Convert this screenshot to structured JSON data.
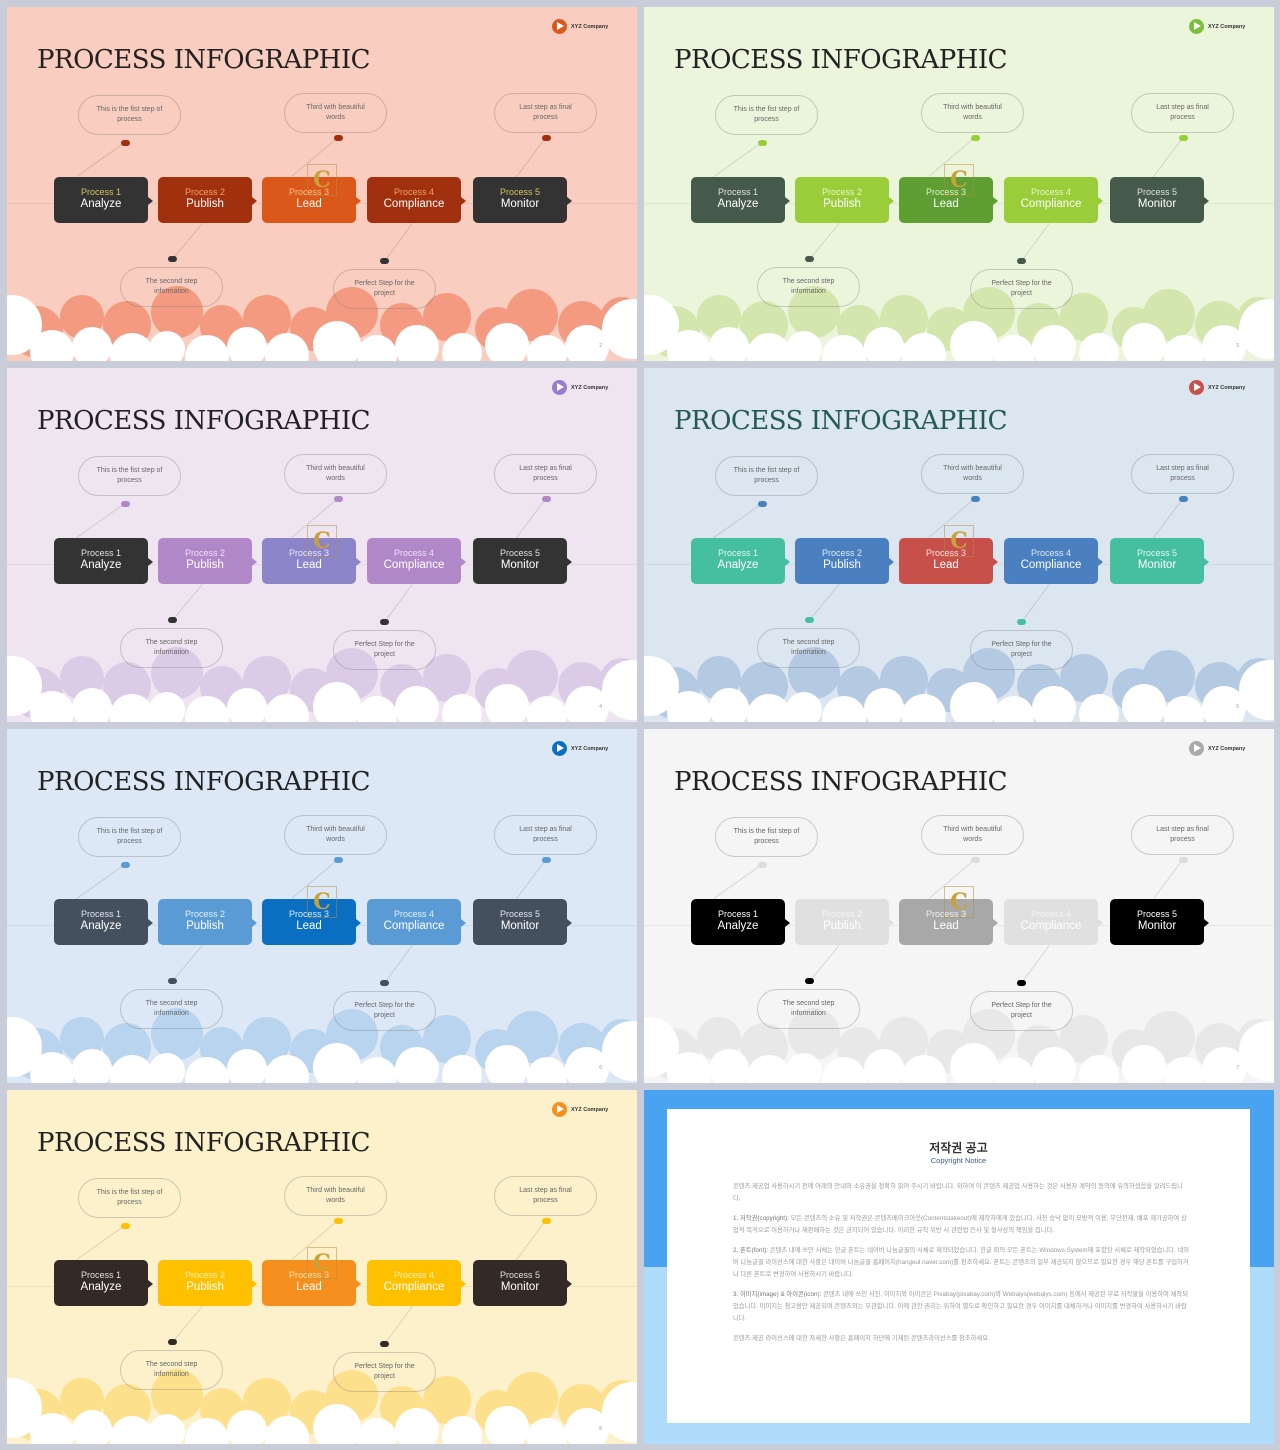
{
  "common": {
    "title": "PROCESS INFOGRAPHIC",
    "logo_text": "XYZ Company",
    "processes": [
      {
        "label": "Process 1",
        "name": "Analyze"
      },
      {
        "label": "Process 2",
        "name": "Publish"
      },
      {
        "label": "Process 3",
        "name": "Lead"
      },
      {
        "label": "Process 4",
        "name": "Compliance"
      },
      {
        "label": "Process 5",
        "name": "Monitor"
      }
    ],
    "bubbles_top": [
      "This is the fist step of process",
      "Third with beautiful words",
      "Last step as final process"
    ],
    "bubbles_bottom": [
      "The second step information",
      "Perfect Step for the project"
    ],
    "watermark": "C"
  },
  "slides": [
    {
      "page": "2",
      "bg": "#f9cdbf",
      "cloud": "#f39a80",
      "title_color": "#222222",
      "logo": "#d9581a",
      "boxes": [
        "#333333",
        "#a1300f",
        "#d9581a",
        "#a1300f",
        "#333333"
      ],
      "labels": [
        "#d8c060",
        "#f0a060",
        "#f8c090",
        "#f0a060",
        "#d8c060"
      ],
      "dot_top": "#a1300f",
      "dot_bottom": "#333333"
    },
    {
      "page": "3",
      "bg": "#ebf5dc",
      "cloud": "#d2e6ad",
      "title_color": "#222222",
      "logo": "#7cbf3a",
      "boxes": [
        "#455a4a",
        "#9acd3a",
        "#5e9e32",
        "#9acd3a",
        "#455a4a"
      ],
      "labels": [
        "#e0e0e0",
        "#e8f5c8",
        "#e0f0c8",
        "#e8f5c8",
        "#e0e0e0"
      ],
      "dot_top": "#9acd3a",
      "dot_bottom": "#455a4a"
    },
    {
      "page": "4",
      "bg": "#eee5f0",
      "cloud": "#dccbe7",
      "title_color": "#222222",
      "logo": "#9a7cc8",
      "boxes": [
        "#333333",
        "#b088c8",
        "#8c84c8",
        "#b088c8",
        "#333333"
      ],
      "labels": [
        "#e0e0e0",
        "#efe0f8",
        "#e8e6f8",
        "#efe0f8",
        "#e0e0e0"
      ],
      "dot_top": "#b088c8",
      "dot_bottom": "#333333"
    },
    {
      "page": "5",
      "bg": "#dce6f0",
      "cloud": "#b4c9e2",
      "title_color": "#245a55",
      "logo": "#c8504a",
      "boxes": [
        "#45bfa0",
        "#4a7fc0",
        "#c8504a",
        "#4a7fc0",
        "#45bfa0"
      ],
      "labels": [
        "#e0f8f0",
        "#e0ecf8",
        "#f8e0e0",
        "#e0ecf8",
        "#e0f8f0"
      ],
      "dot_top": "#4a7fc0",
      "dot_bottom": "#45bfa0"
    },
    {
      "page": "6",
      "bg": "#dce8f6",
      "cloud": "#b8d4ee",
      "title_color": "#222222",
      "logo": "#0a6fc0",
      "boxes": [
        "#45505f",
        "#5b9bd5",
        "#0a6fc0",
        "#5b9bd5",
        "#45505f"
      ],
      "labels": [
        "#e0e6ee",
        "#e6f0fa",
        "#d8eafa",
        "#e6f0fa",
        "#e0e6ee"
      ],
      "dot_top": "#5b9bd5",
      "dot_bottom": "#45505f"
    },
    {
      "page": "7",
      "bg": "#f5f5f5",
      "cloud": "#e8e8e8",
      "title_color": "#222222",
      "logo": "#aaaaaa",
      "boxes": [
        "#000000",
        "#e0e0e0",
        "#a8a8a8",
        "#e0e0e0",
        "#000000"
      ],
      "labels": [
        "#ffffff",
        "#f4f4f4",
        "#eeeeee",
        "#f4f4f4",
        "#ffffff"
      ],
      "dot_top": "#dddddd",
      "dot_bottom": "#000000"
    },
    {
      "page": "8",
      "bg": "#fdf1cb",
      "cloud": "#fde08c",
      "title_color": "#222222",
      "logo": "#f5901e",
      "boxes": [
        "#332a25",
        "#ffc000",
        "#f5901e",
        "#ffc000",
        "#332a25"
      ],
      "labels": [
        "#e0e0e0",
        "#fff0b0",
        "#ffe0b0",
        "#fff0b0",
        "#e0e0e0"
      ],
      "dot_top": "#ffc000",
      "dot_bottom": "#332a25"
    }
  ],
  "copyright": {
    "title": "저작권 공고",
    "subtitle": "Copyright Notice",
    "intro": "콘텐츠 제공업 사용하시기 전에 아래의 안내와 소유권을 정확히 읽어 주시기 바랍니다. 위하여 이 콘텐츠 제공업 사용하는 것은 사용자 계약의 동의에 유의하셨음을 알려드립니다.",
    "sections": [
      {
        "head": "1. 저작권(copyright):",
        "text": "모든 콘텐츠의 소유 및 저작권은 콘텐츠메이크아웃(Contentstakeout)에 제작자에게 있습니다. 사전 승낙 없이 모방적 이용, 무단전재, 배포 재가공하여 상업적 목적으로 이용하거나 재판매하는 것은 금지되어 있습니다. 이러한 규칙 위반 시 관련법 민사 및 형사상의 책임을 집니다."
      },
      {
        "head": "2. 폰트(font):",
        "text": "콘텐츠 내에 쓰인 서체는 한글 폰트는 네이버 나눔글꼴의 서체로 제작되었습니다. 한글 외의 모든 폰트는 Windows System에 포함된 서체로 제작되었습니다. 네이버 나눔글꼴 라이선스에 대한 사항은 네이버 나눔글꼴 홈페이지(hangeul.naver.com)를 참조하세요. 폰트는 콘텐츠의 일부 제공되지 않으므로 필요한 경우 해당 폰트를 구입하거나 다른 폰트로 변경하여 사용하시기 바랍니다."
      },
      {
        "head": "3. 이미지(image) & 아이콘(icon):",
        "text": "콘텐츠 내에 쓰인 사진, 이미지와 아이콘은 Pixabay(pixabay.com)와 Webalys(webalys.com) 등에서 제공된 무료 저작물을 이용하여 제작되었습니다. 이미지는 참고용만 제공되며 콘텐츠와는 무관합니다. 이에 관한 권리는 위하여 별도로 확인하고 필요한 경우 이미지를 대체하거나 이미지를 변경하여 사용하시기 바랍니다."
      }
    ],
    "footer": "콘텐츠 제공 라이선스에 대한 자세한 사항은 홈페이지 하단에 기재된 콘텐츠라이선스를 참조하세요."
  }
}
